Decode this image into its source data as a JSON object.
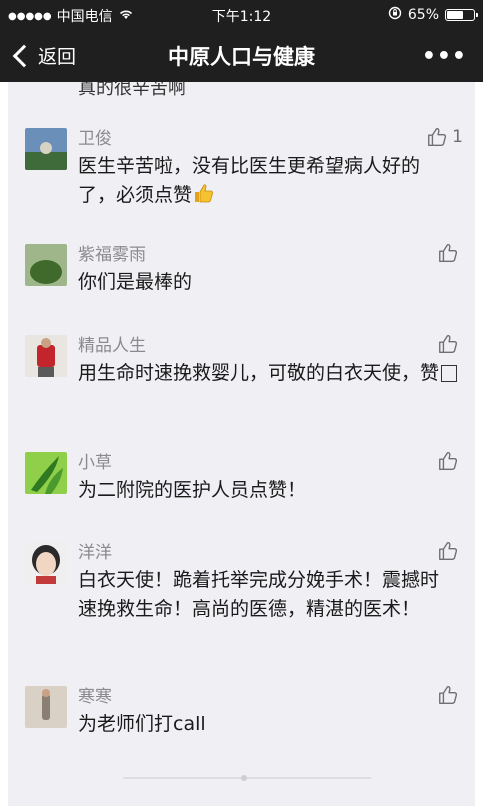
{
  "status_bar": {
    "signal": "●●●●●",
    "carrier": "中国电信",
    "time": "下午1:12",
    "battery_text": "65%",
    "battery_level": 0.65,
    "icons": [
      "wifi-icon",
      "rotation-lock-icon",
      "battery-icon"
    ]
  },
  "nav": {
    "back_label": "返回",
    "title": "中原人口与健康",
    "more_label": "•••"
  },
  "cut_text": "真的很辛苦啊",
  "comments": [
    {
      "name": "卫俊",
      "text": "医生辛苦啦，没有比医生更希望病人好的了，必须点赞",
      "has_thumb_emoji": true,
      "likes": "1",
      "avatar_colors": [
        "#6a8fb8",
        "#3f6b3a"
      ]
    },
    {
      "name": "紫福雾雨",
      "text": "你们是最棒的",
      "likes": "",
      "avatar_colors": [
        "#9fb68a",
        "#3f6a2c"
      ]
    },
    {
      "name": "精品人生",
      "text": "用生命时速挽救婴儿，可敬的白衣天使，赞",
      "has_box_char": true,
      "likes": "",
      "avatar_colors": [
        "#c2262c",
        "#5a5a5a"
      ]
    },
    {
      "name": "小草",
      "text": "为二附院的医护人员点赞！",
      "likes": "",
      "avatar_colors": [
        "#8fcf4a",
        "#2f7a21"
      ]
    },
    {
      "name": "洋洋",
      "text": "白衣天使！跪着托举完成分娩手术！震撼时速挽救生命！高尚的医德，精湛的医术！",
      "likes": "",
      "avatar_colors": [
        "#f1d6c4",
        "#2a2a2a"
      ]
    },
    {
      "name": "寒寒",
      "text": "为老师们打call",
      "likes": "",
      "avatar_colors": [
        "#d9d1c6",
        "#8a7f72"
      ]
    }
  ],
  "colors": {
    "header_bg": "#1f1f1f",
    "content_bg": "#f0eff4",
    "name_color": "#8b8b8f",
    "text_color": "#1a1a1a"
  }
}
